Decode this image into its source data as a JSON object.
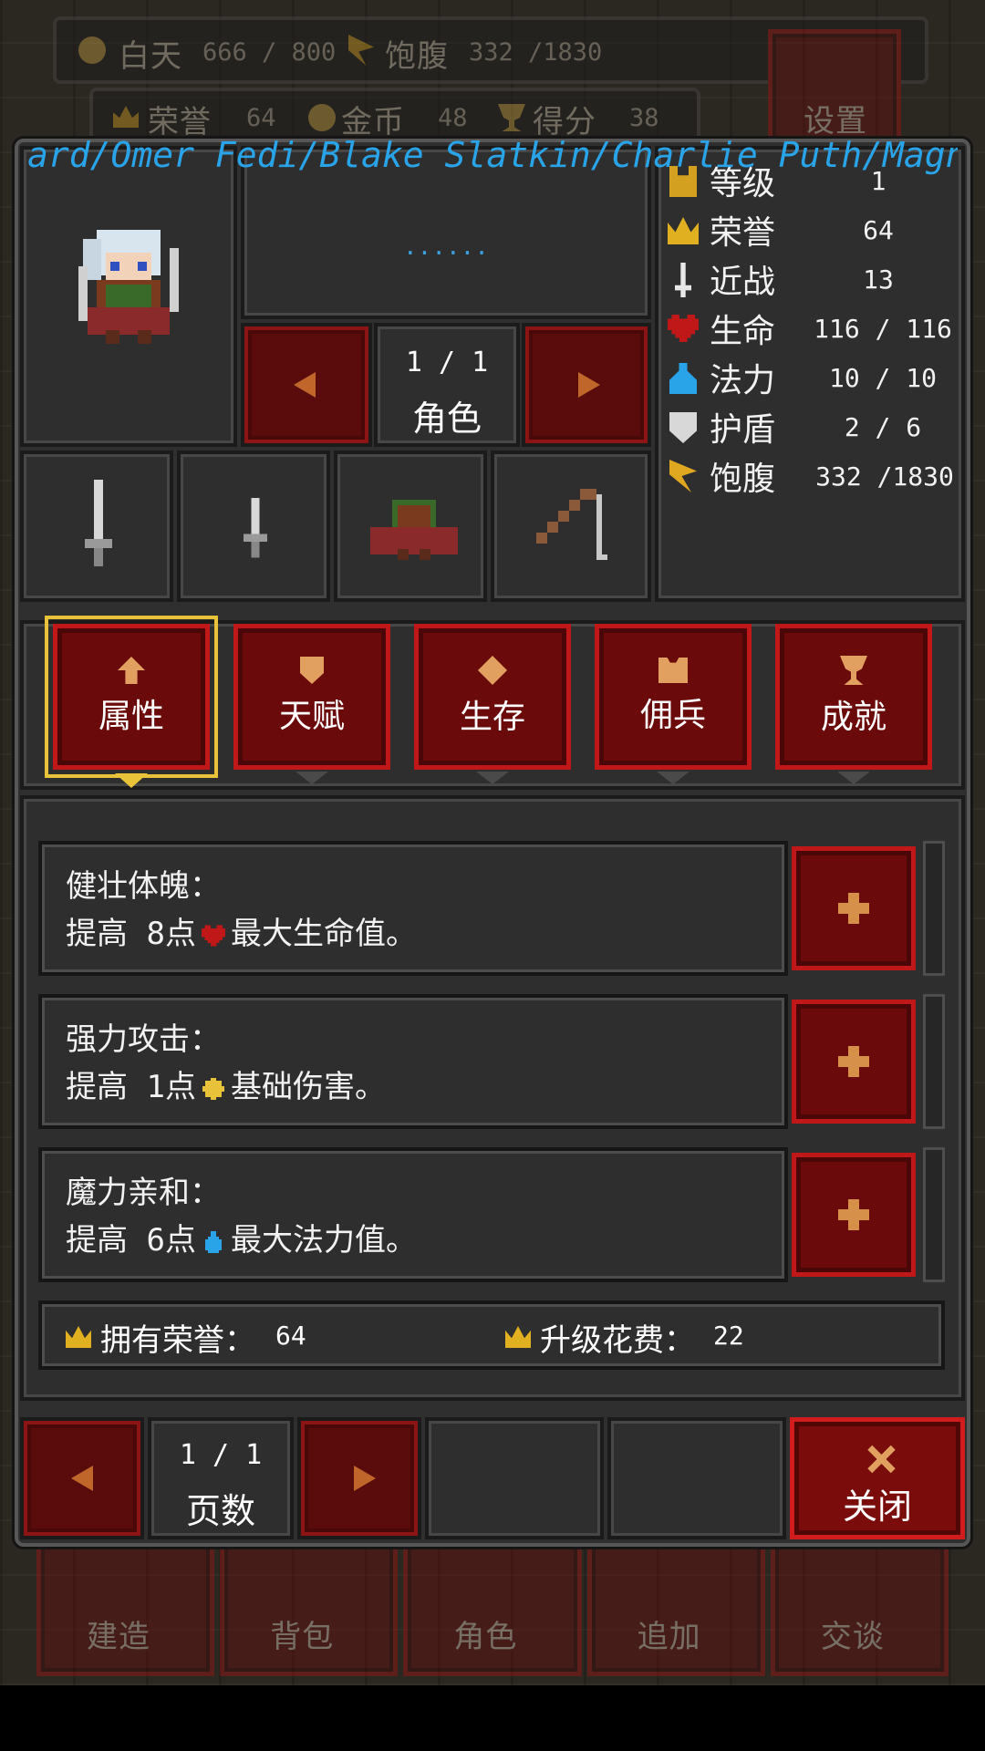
{
  "ticker": "ard/Omer Fedi/Blake Slatkin/Charlie Puth/Magnus Hoiberg",
  "hud": {
    "day_label": "白天",
    "day_value": "666 / 800",
    "hunger_label": "饱腹",
    "hunger_value": "332 /1830",
    "honor_label": "荣誉",
    "honor_value": "64",
    "gold_label": "金币",
    "gold_value": "48",
    "score_label": "得分",
    "score_value": "38",
    "settings_label": "设置"
  },
  "character": {
    "name_placeholder": "......",
    "page": "1 / 1",
    "page_label": "角色"
  },
  "stats": [
    {
      "icon": "level-icon",
      "label": "等级",
      "value": "1"
    },
    {
      "icon": "crown-icon",
      "label": "荣誉",
      "value": "64"
    },
    {
      "icon": "sword-icon",
      "label": "近战",
      "value": "13"
    },
    {
      "icon": "heart-icon",
      "label": "生命",
      "value": "116 / 116"
    },
    {
      "icon": "potion-icon",
      "label": "法力",
      "value": "10 / 10"
    },
    {
      "icon": "shield-icon",
      "label": "护盾",
      "value": "2 / 6"
    },
    {
      "icon": "hunger-icon",
      "label": "饱腹",
      "value": "332 /1830"
    }
  ],
  "equipment": [
    "sword-icon",
    "dagger-icon",
    "armor-icon",
    "rod-icon"
  ],
  "tabs": [
    {
      "label": "属性",
      "icon": "arrow-up-icon",
      "selected": true
    },
    {
      "label": "天赋",
      "icon": "shield-icon",
      "selected": false
    },
    {
      "label": "生存",
      "icon": "diamond-icon",
      "selected": false
    },
    {
      "label": "佣兵",
      "icon": "armor-icon",
      "selected": false
    },
    {
      "label": "成就",
      "icon": "trophy-icon",
      "selected": false
    }
  ],
  "attributes": [
    {
      "title": "健壮体魄：",
      "prefix": "提高 8点",
      "icon": "heart-icon",
      "suffix": "最大生命值。"
    },
    {
      "title": "强力攻击：",
      "prefix": "提高 1点",
      "icon": "damage-icon",
      "suffix": "基础伤害。"
    },
    {
      "title": "魔力亲和：",
      "prefix": "提高 6点",
      "icon": "potion-icon",
      "suffix": "最大法力值。"
    }
  ],
  "honor_owned_label": "拥有荣誉：",
  "honor_owned_value": "64",
  "upgrade_cost_label": "升级花费：",
  "upgrade_cost_value": "22",
  "footer": {
    "page": "1 / 1",
    "page_label": "页数",
    "close_label": "关闭"
  },
  "bottom_nav": [
    "建造",
    "背包",
    "角色",
    "追加",
    "交谈"
  ],
  "colors": {
    "accent_red": "#c01818",
    "selected_gold": "#e8c238",
    "ticker_blue": "#2aa4e8"
  }
}
